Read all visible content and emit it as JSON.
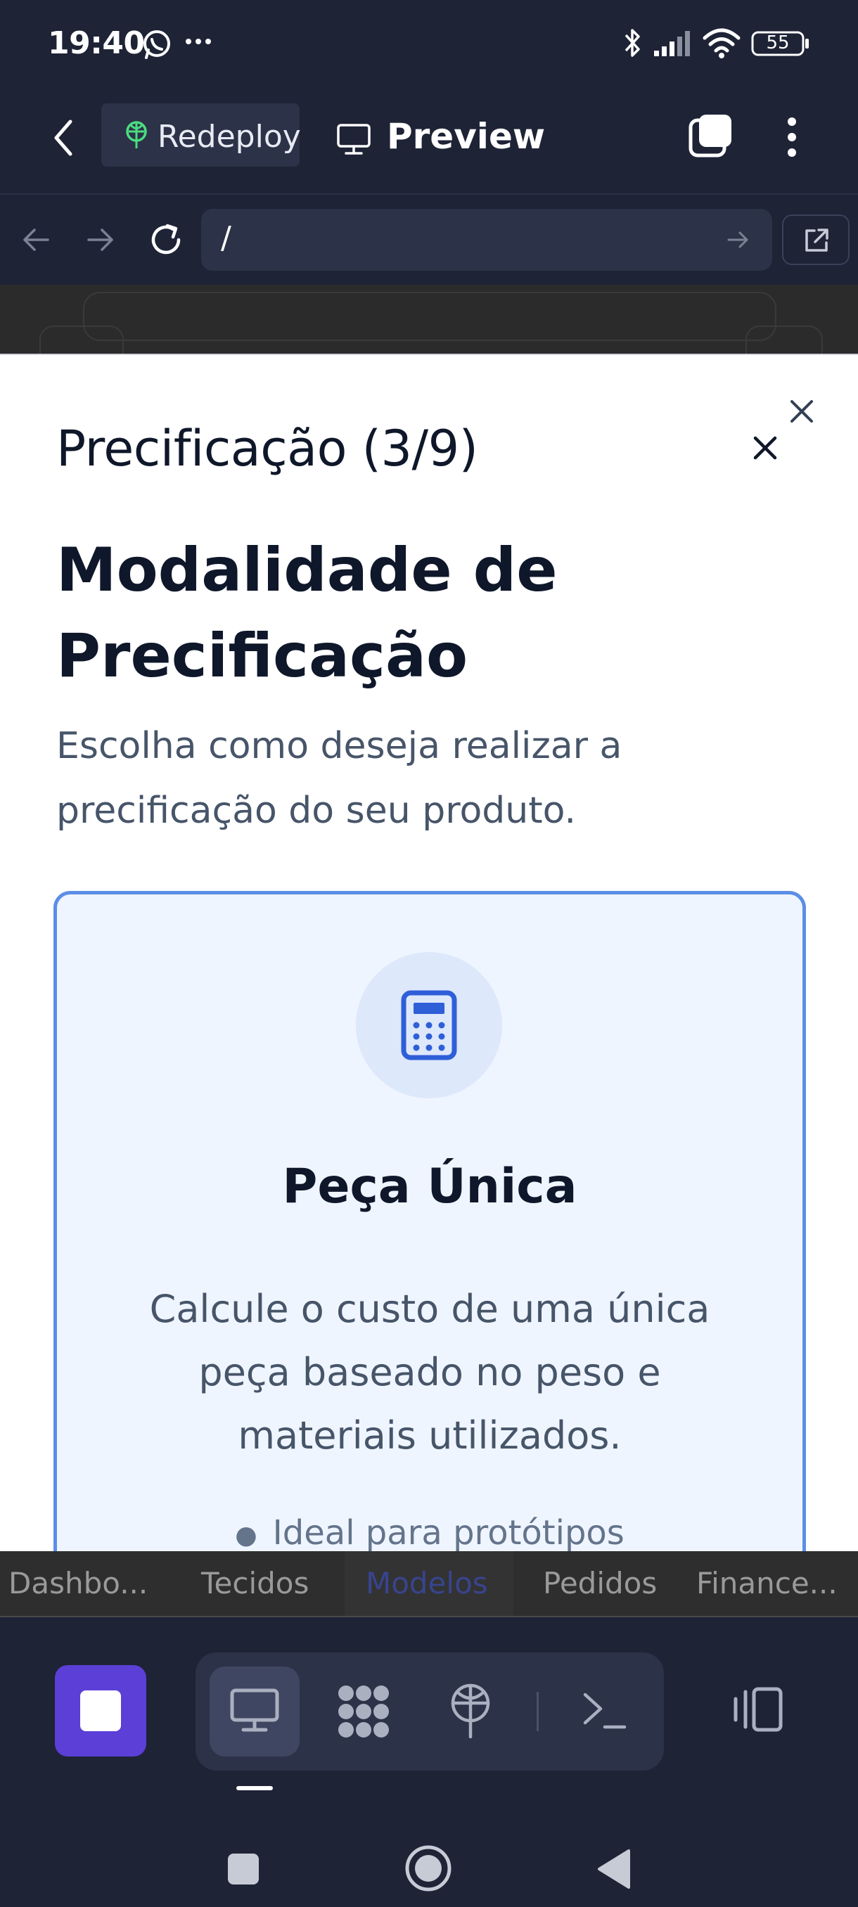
{
  "status_bar": {
    "time": "19:40",
    "battery": "55",
    "icons": [
      "whatsapp-icon",
      "more-dots-icon",
      "bluetooth-icon",
      "signal-icon",
      "wifi-icon",
      "battery-icon"
    ]
  },
  "header": {
    "back_icon": "back-arrow-icon",
    "redeploy_label": "Redeploy",
    "preview_label": "Preview",
    "icons": [
      "redeploy-icon",
      "monitor-icon",
      "tabs-icon",
      "kebab-menu-icon"
    ]
  },
  "url_bar": {
    "value": "/",
    "icons": [
      "back-icon",
      "forward-icon",
      "reload-icon",
      "go-arrow-icon",
      "open-external-icon"
    ]
  },
  "modal": {
    "dialog_title": "Precificação (3/9)",
    "heading": "Modalidade de Precificação",
    "subtitle": "Escolha como deseja realizar a precificação do seu produto.",
    "card": {
      "icon": "calculator-icon",
      "title": "Peça Única",
      "description": "Calcule o custo de uma única peça baseado no peso e materiais utilizados.",
      "bullet": "Ideal para protótipos"
    },
    "accent_color": "#5b8ee6"
  },
  "app_tabs": [
    "Dashbo...",
    "Tecidos",
    "Modelos",
    "Pedidos",
    "Finance..."
  ],
  "app_tabs_active": "Modelos",
  "ide_toolbar": {
    "icons": [
      "stop-icon",
      "desktop-preview-icon",
      "packages-icon",
      "deploy-icon",
      "terminal-icon",
      "layout-toggle-icon"
    ],
    "stop_color": "#5b3fd6"
  },
  "nav_bar": {
    "icons": [
      "recents-icon",
      "home-icon",
      "back-triangle-icon"
    ]
  }
}
